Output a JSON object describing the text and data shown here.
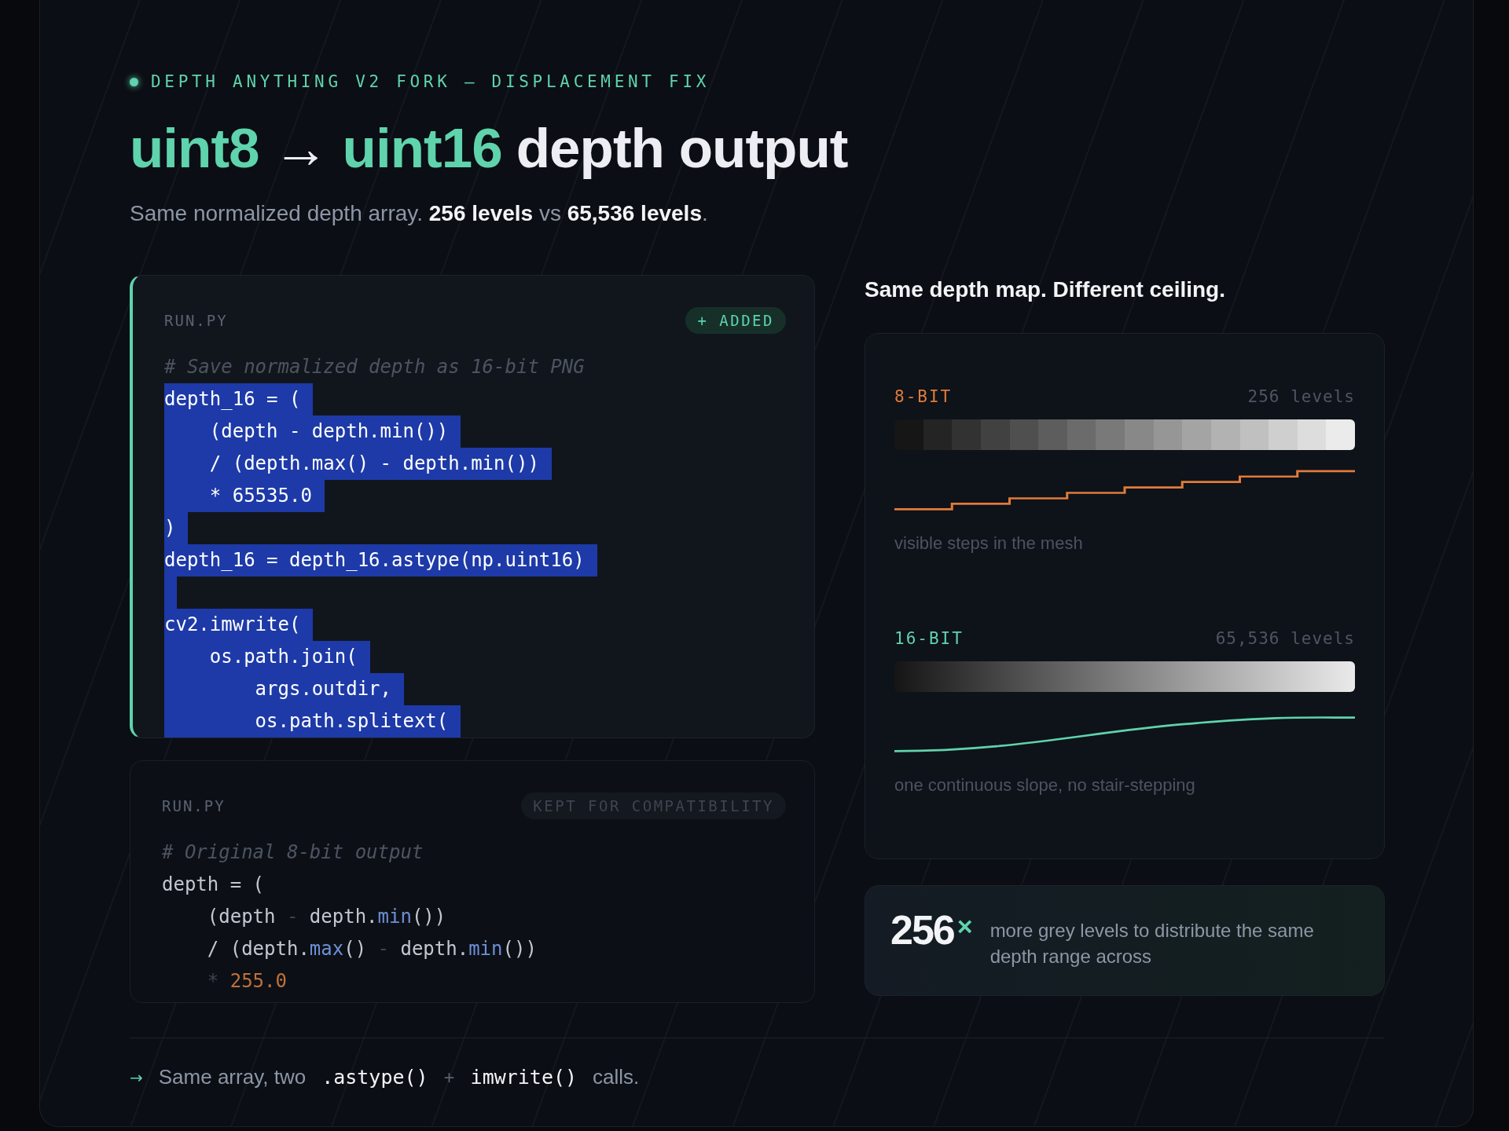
{
  "eyebrow": "DEPTH ANYTHING V2 FORK — DISPLACEMENT FIX",
  "title": [
    {
      "text": "uint8",
      "accent": true
    },
    {
      "text": "→",
      "accent": false
    },
    {
      "text": "uint16",
      "accent": true
    },
    {
      "text": "depth output",
      "accent": false
    }
  ],
  "subtitle": "Same normalized depth array. **256 levels** vs **65,536 levels**.",
  "code_cards": [
    {
      "file": "RUN.PY",
      "kind": "added",
      "badge": "+ ADDED",
      "lines": [
        {
          "selected": false,
          "tokens": [
            {
              "kind": "comment",
              "text": "# Save normalized depth as 16-bit PNG"
            }
          ]
        },
        {
          "selected": true,
          "tokens": [
            {
              "kind": "plain",
              "text": "depth_16 = ("
            }
          ]
        },
        {
          "selected": true,
          "tokens": [
            {
              "kind": "plain",
              "text": "    (depth - depth.min())"
            }
          ]
        },
        {
          "selected": true,
          "tokens": [
            {
              "kind": "plain",
              "text": "    / (depth.max() - depth.min())"
            }
          ]
        },
        {
          "selected": true,
          "tokens": [
            {
              "kind": "plain",
              "text": "    * 65535.0"
            }
          ]
        },
        {
          "selected": true,
          "tokens": [
            {
              "kind": "plain",
              "text": ")"
            }
          ]
        },
        {
          "selected": true,
          "tokens": [
            {
              "kind": "plain",
              "text": "depth_16 = depth_16.astype(np.uint16)"
            }
          ]
        },
        {
          "selected": true
        },
        {
          "selected": true,
          "tokens": [
            {
              "kind": "plain",
              "text": "cv2.imwrite("
            }
          ]
        },
        {
          "selected": true,
          "tokens": [
            {
              "kind": "plain",
              "text": "    os.path.join("
            }
          ]
        },
        {
          "selected": true,
          "tokens": [
            {
              "kind": "plain",
              "text": "        args.outdir,"
            }
          ]
        },
        {
          "selected": true,
          "tokens": [
            {
              "kind": "plain",
              "text": "        os.path.splitext("
            }
          ]
        }
      ]
    },
    {
      "file": "RUN.PY",
      "kind": "kept",
      "badge": "KEPT FOR COMPATIBILITY",
      "lines": [
        {
          "selected": false,
          "tokens": [
            {
              "kind": "comment",
              "text": "# Original 8-bit output"
            }
          ]
        },
        {
          "selected": false,
          "tokens": [
            {
              "kind": "plain",
              "text": "depth = ("
            }
          ]
        },
        {
          "selected": false,
          "tokens": [
            {
              "kind": "plain",
              "text": "    (depth "
            },
            {
              "kind": "op",
              "text": "-"
            },
            {
              "kind": "plain",
              "text": " depth."
            },
            {
              "kind": "method",
              "text": "min"
            },
            {
              "kind": "plain",
              "text": "())"
            }
          ]
        },
        {
          "selected": false,
          "tokens": [
            {
              "kind": "plain",
              "text": "    / (depth."
            },
            {
              "kind": "method",
              "text": "max"
            },
            {
              "kind": "plain",
              "text": "() "
            },
            {
              "kind": "op",
              "text": "-"
            },
            {
              "kind": "plain",
              "text": " depth."
            },
            {
              "kind": "method",
              "text": "min"
            },
            {
              "kind": "plain",
              "text": "())"
            }
          ]
        },
        {
          "selected": false,
          "tokens": [
            {
              "kind": "op",
              "text": "    *"
            },
            {
              "kind": "number",
              "text": " 255.0"
            }
          ]
        }
      ]
    }
  ],
  "compare": {
    "heading": "Same depth map. Different ceiling.",
    "rows": [
      {
        "kind": "stepped",
        "label": "8-BIT",
        "levels": "256 levels",
        "caption": "visible steps in the mesh"
      },
      {
        "kind": "smooth",
        "label": "16-BIT",
        "levels": "65,536 levels",
        "caption": "one continuous slope, no stair-stepping"
      }
    ]
  },
  "stat": {
    "value": "256",
    "unit": "×",
    "text": "more grey levels to distribute the same depth range across"
  },
  "footer": {
    "arrow": "→",
    "parts": [
      {
        "kind": "text",
        "text": "Same array, two"
      },
      {
        "kind": "code",
        "text": ".astype()"
      },
      {
        "kind": "op",
        "text": "+"
      },
      {
        "kind": "code",
        "text": "imwrite()"
      },
      {
        "kind": "text",
        "text": "calls."
      }
    ]
  }
}
